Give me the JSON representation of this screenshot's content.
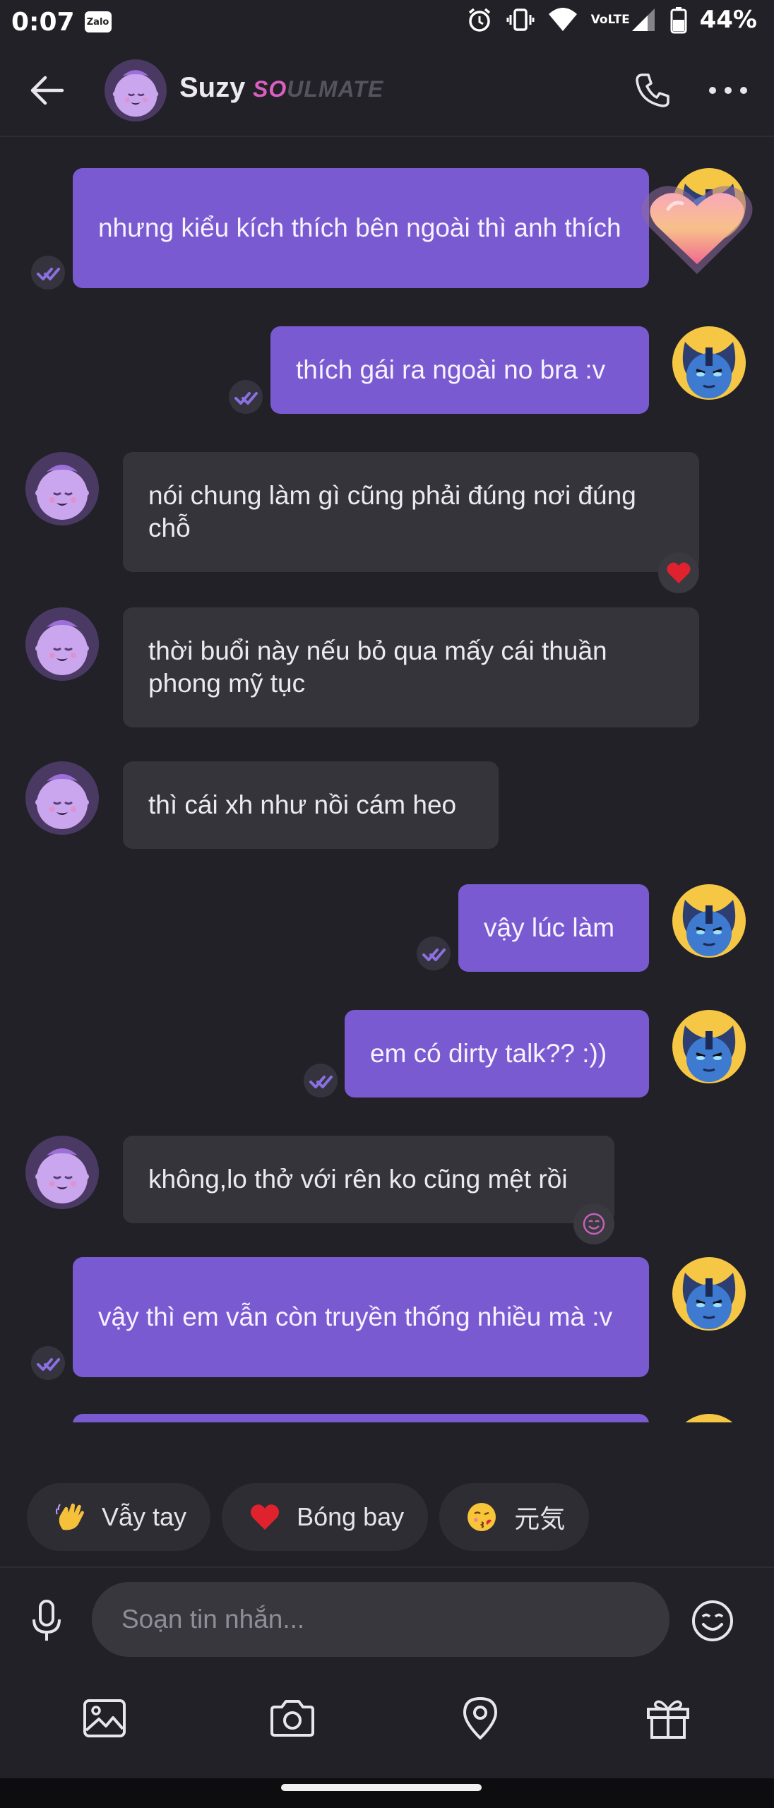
{
  "status_bar": {
    "time": "0:07",
    "app_badge": "Zalo",
    "network": "VoLTE",
    "battery": "44%",
    "icons": [
      "alarm-icon",
      "vibrate-icon",
      "wifi-icon",
      "volte-icon",
      "signal-icon",
      "battery-icon"
    ]
  },
  "header": {
    "name": "Suzy",
    "badge_so": "SO",
    "badge_rest": "ULMATE",
    "badge_colors": {
      "so": "#d95fc0",
      "rest": "#55545e"
    },
    "icons": {
      "back": "arrow-left-icon",
      "call": "phone-icon",
      "more": "more-horizontal-icon"
    }
  },
  "messages": [
    {
      "from": "me",
      "text": "nhưng kiểu kích thích bên ngoài thì anh thích",
      "status": "read",
      "overlay": "heart-sticker"
    },
    {
      "from": "me",
      "text": "thích gái ra ngoài no bra :v",
      "status": "read"
    },
    {
      "from": "suzy",
      "text": "nói chung làm gì cũng phải đúng nơi đúng chỗ",
      "reaction": "heart"
    },
    {
      "from": "suzy",
      "text": "thời buổi này nếu bỏ qua mấy cái thuần phong mỹ tục"
    },
    {
      "from": "suzy",
      "text": "thì cái xh như nồi cám heo"
    },
    {
      "from": "me",
      "text": "vậy lúc làm",
      "status": "read"
    },
    {
      "from": "me",
      "text": "em có dirty talk?? :))",
      "status": "read"
    },
    {
      "from": "suzy",
      "text": "không,lo thở với rên ko cũng mệt rồi",
      "reaction": "smile"
    },
    {
      "from": "me",
      "text": "vậy thì em vẫn còn truyền thống nhiều mà :v",
      "status": "read"
    }
  ],
  "quick_reactions": [
    {
      "emoji": "waving-hand",
      "label": "Vẫy tay"
    },
    {
      "emoji": "red-heart",
      "label": "Bóng bay"
    },
    {
      "emoji": "kissing-face",
      "label": "元気"
    }
  ],
  "composer": {
    "placeholder": "Soạn tin nhắn...",
    "icons": [
      "microphone-icon",
      "emoji-icon"
    ]
  },
  "toolbar": {
    "icons": [
      "image-icon",
      "camera-icon",
      "location-icon",
      "gift-icon"
    ]
  },
  "colors": {
    "background": "#212127",
    "outgoing_bubble": "#7a5ad0",
    "incoming_bubble": "#35343b",
    "accent": "#7a5ad0"
  }
}
